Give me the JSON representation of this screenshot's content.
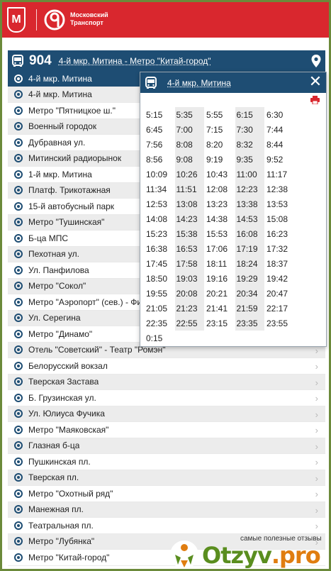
{
  "header": {
    "brand_line1": "Московский",
    "brand_line2": "Транспорт",
    "crest_glyph": "М"
  },
  "route": {
    "number": "904",
    "name": "4-й мкр. Митина - Метро \"Китай-город\""
  },
  "stops": [
    "4-й мкр. Митина",
    "4-й мкр. Митина",
    "Метро \"Пятницкое ш.\"",
    "Военный городок",
    "Дубравная ул.",
    "Митинский радиорынок",
    "1-й мкр. Митина",
    "Платф. Трикотажная",
    "15-й автобусный парк",
    "Метро \"Тушинская\"",
    "Б-ца МПС",
    "Пехотная ул.",
    "Ул. Панфилова",
    "Метро \"Сокол\"",
    "Метро \"Аэропорт\" (сев.) - Фи",
    "Ул. Серегина",
    "Метро \"Динамо\"",
    "Отель \"Советский\" - Театр \"Ромэн\"",
    "Белорусский вокзал",
    "Тверская Застава",
    "Б. Грузинская ул.",
    "Ул. Юлиуса Фучика",
    "Метро \"Маяковская\"",
    "Глазная б-ца",
    "Пушкинская пл.",
    "Тверская пл.",
    "Метро \"Охотный ряд\"",
    "Манежная пл.",
    "Театральная пл.",
    "Метро \"Лубянка\"",
    "Метро \"Китай-город\""
  ],
  "popup": {
    "title": "4-й мкр. Митина",
    "close": "✕",
    "times": [
      "5:15",
      "5:35",
      "5:55",
      "6:15",
      "6:30",
      "6:45",
      "7:00",
      "7:15",
      "7:30",
      "7:44",
      "7:56",
      "8:08",
      "8:20",
      "8:32",
      "8:44",
      "8:56",
      "9:08",
      "9:19",
      "9:35",
      "9:52",
      "10:09",
      "10:26",
      "10:43",
      "11:00",
      "11:17",
      "11:34",
      "11:51",
      "12:08",
      "12:23",
      "12:38",
      "12:53",
      "13:08",
      "13:23",
      "13:38",
      "13:53",
      "14:08",
      "14:23",
      "14:38",
      "14:53",
      "15:08",
      "15:23",
      "15:38",
      "15:53",
      "16:08",
      "16:23",
      "16:38",
      "16:53",
      "17:06",
      "17:19",
      "17:32",
      "17:45",
      "17:58",
      "18:11",
      "18:24",
      "18:37",
      "18:50",
      "19:03",
      "19:16",
      "19:29",
      "19:42",
      "19:55",
      "20:08",
      "20:21",
      "20:34",
      "20:47",
      "21:05",
      "21:23",
      "21:41",
      "21:59",
      "22:17",
      "22:35",
      "22:55",
      "23:15",
      "23:35",
      "23:55",
      "0:15"
    ]
  },
  "watermark": {
    "caption": "самые полезные отзывы",
    "site_main": "Otzyv",
    "site_tld": ".pro"
  },
  "colors": {
    "brand_red": "#d9272e",
    "header_blue": "#1e4d73",
    "row_alt": "#ececec"
  },
  "icons": {
    "route": "bus-icon",
    "location": "map-pin-icon",
    "stop": "stop-target-icon",
    "next": "chevron-right-icon",
    "print": "printer-icon"
  }
}
